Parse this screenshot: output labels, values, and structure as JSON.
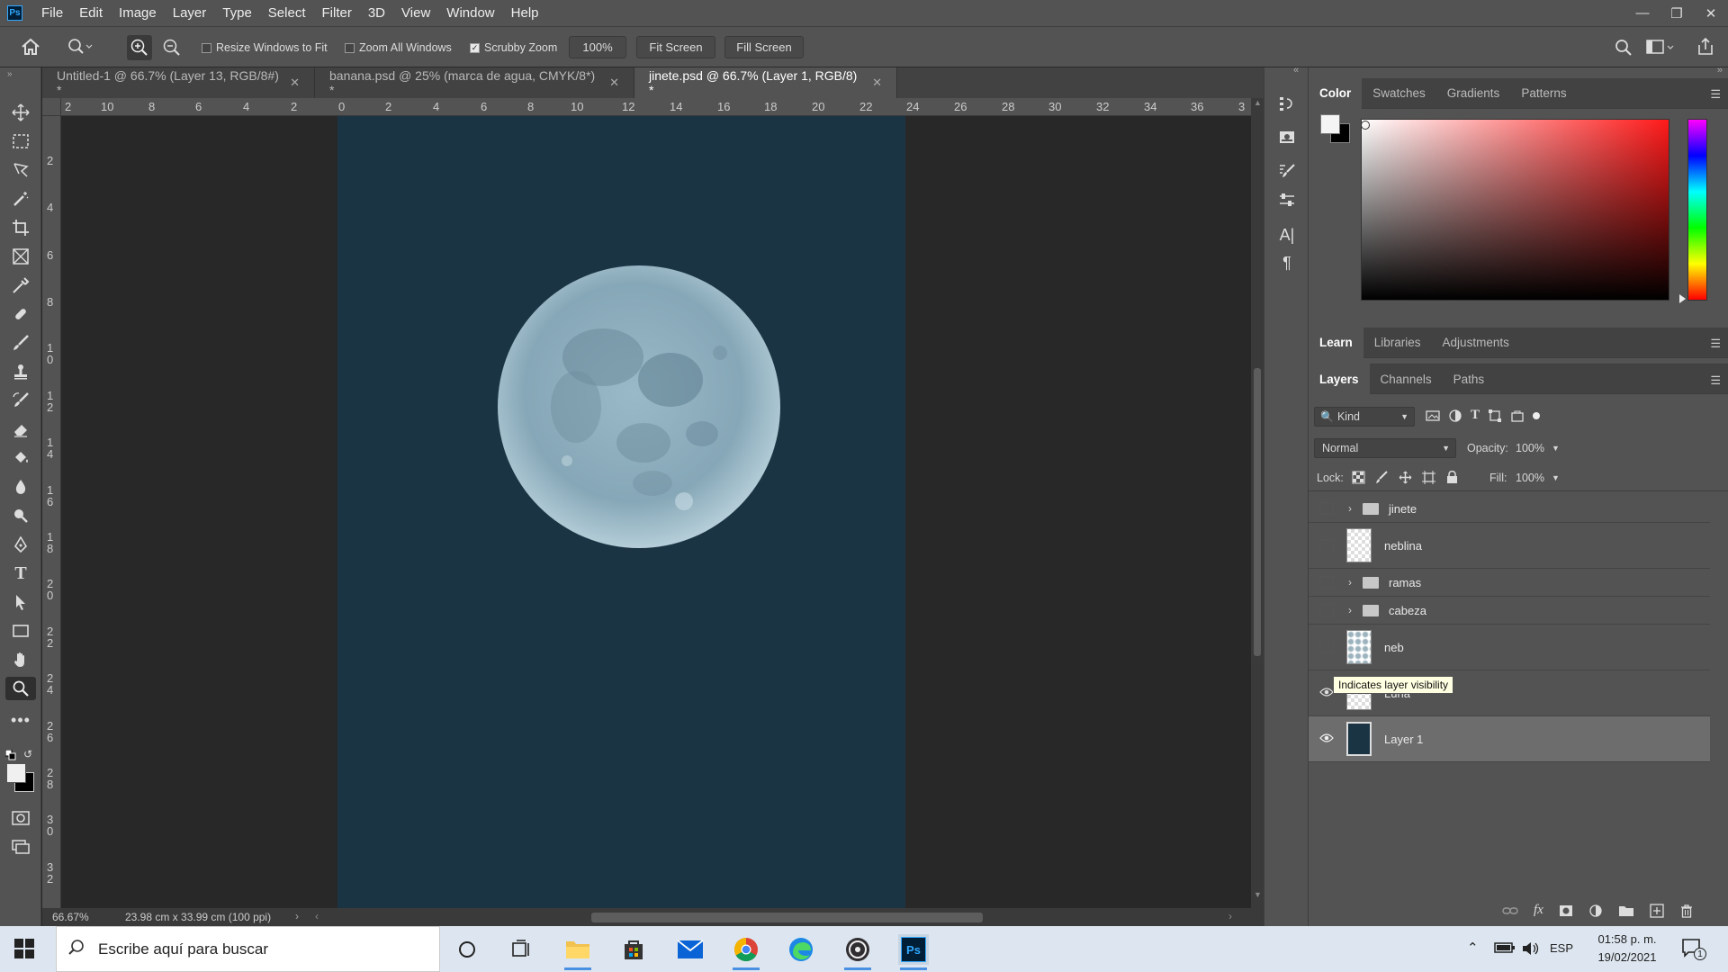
{
  "app": {
    "logo_text": "Ps"
  },
  "menu": [
    "File",
    "Edit",
    "Image",
    "Layer",
    "Type",
    "Select",
    "Filter",
    "3D",
    "View",
    "Window",
    "Help"
  ],
  "options": {
    "resize_windows": {
      "label": "Resize Windows to Fit",
      "checked": false
    },
    "zoom_all": {
      "label": "Zoom All Windows",
      "checked": false
    },
    "scrubby_zoom": {
      "label": "Scrubby Zoom",
      "checked": true
    },
    "zoom_value": "100%",
    "fit_screen": "Fit Screen",
    "fill_screen": "Fill Screen"
  },
  "doc_tabs": [
    {
      "label": "Untitled-1 @ 66.7% (Layer 13, RGB/8#) *",
      "active": false
    },
    {
      "label": "banana.psd @ 25% (marca de agua, CMYK/8*) *",
      "active": false
    },
    {
      "label": "jinete.psd @ 66.7% (Layer 1, RGB/8) *",
      "active": true
    }
  ],
  "rulers": {
    "top": [
      "2",
      "10",
      "8",
      "6",
      "4",
      "2",
      "0",
      "2",
      "4",
      "6",
      "8",
      "10",
      "12",
      "14",
      "16",
      "18",
      "20",
      "22",
      "24",
      "26",
      "28",
      "30",
      "32",
      "34",
      "36",
      "3"
    ],
    "left": [
      "2",
      "4",
      "6",
      "8",
      "1 0",
      "1 2",
      "1 4",
      "1 6",
      "1 8",
      "2 0",
      "2 2",
      "2 4",
      "2 6",
      "2 8",
      "3 0",
      "3 2"
    ]
  },
  "status": {
    "zoom": "66.67%",
    "doc_size": "23.98 cm x 33.99 cm (100 ppi)"
  },
  "color_panel": {
    "tabs": [
      "Color",
      "Swatches",
      "Gradients",
      "Patterns"
    ],
    "active_tab": "Color",
    "hue_color": "#ff1a1a"
  },
  "learn_panel": {
    "tabs": [
      "Learn",
      "Libraries",
      "Adjustments"
    ],
    "active_tab": "Learn"
  },
  "layers_panel": {
    "tabs": [
      "Layers",
      "Channels",
      "Paths"
    ],
    "active_tab": "Layers",
    "filter_kind": "Kind",
    "blend_mode": "Normal",
    "opacity_label": "Opacity:",
    "opacity_value": "100%",
    "lock_label": "Lock:",
    "fill_label": "Fill:",
    "fill_value": "100%",
    "layers": [
      {
        "name": "jinete",
        "type": "folder",
        "visible": false
      },
      {
        "name": "neblina",
        "type": "pixel",
        "visible": false
      },
      {
        "name": "ramas",
        "type": "folder",
        "visible": false
      },
      {
        "name": "cabeza",
        "type": "folder",
        "visible": false
      },
      {
        "name": "neb",
        "type": "pixel",
        "visible": false
      },
      {
        "name": "Luna",
        "type": "pixel",
        "visible": true
      },
      {
        "name": "Layer 1",
        "type": "fill",
        "visible": true,
        "selected": true
      }
    ]
  },
  "tooltip": "Indicates layer visibility",
  "colors": {
    "doc_bg": "#1b3444",
    "moon": "#8fb0c0",
    "panel": "#535353",
    "canvas": "#282828"
  },
  "taskbar": {
    "search_placeholder": "Escribe aquí para buscar",
    "lang": "ESP",
    "time": "01:58 p. m.",
    "date": "19/02/2021",
    "notification_count": "1"
  }
}
